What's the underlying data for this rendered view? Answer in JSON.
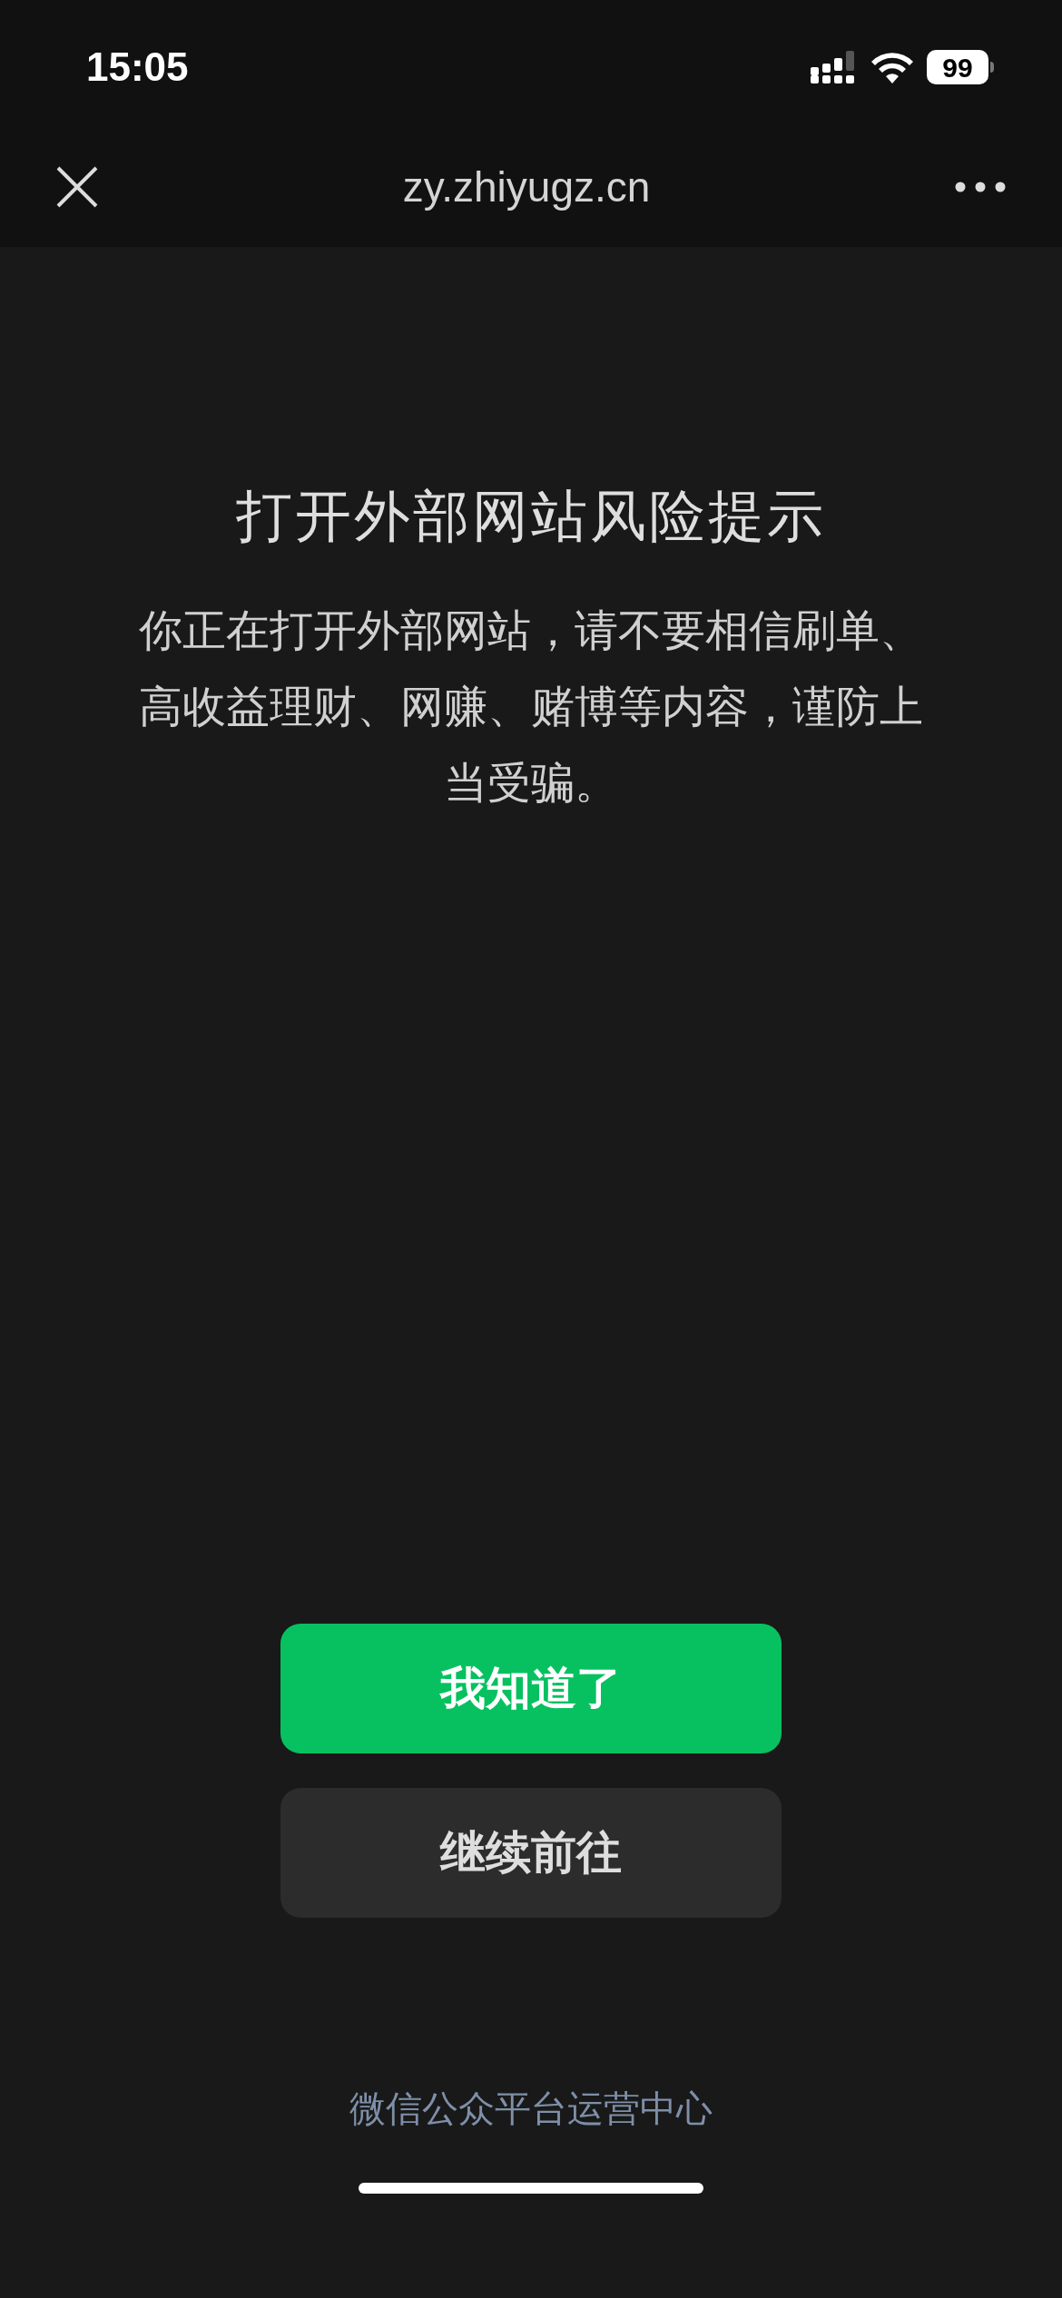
{
  "status_bar": {
    "time": "15:05",
    "battery": "99"
  },
  "nav_bar": {
    "title": "zy.zhiyugz.cn"
  },
  "notice": {
    "title": "打开外部网站风险提示",
    "message": "你正在打开外部网站，请不要相信刷单、高收益理财、网赚、赌博等内容，谨防上当受骗。"
  },
  "buttons": [
    {
      "label": "我知道了",
      "kind": "primary"
    },
    {
      "label": "继续前往",
      "kind": "secondary"
    }
  ],
  "footer": "微信公众平台运营中心"
}
